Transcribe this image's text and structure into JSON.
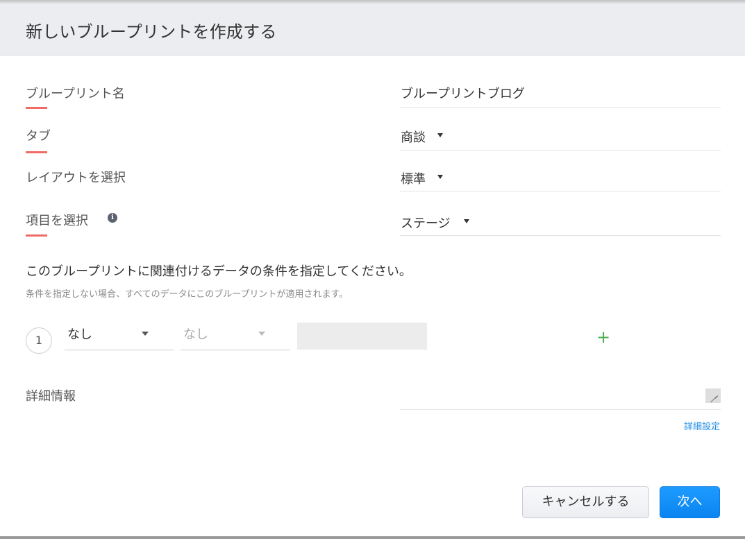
{
  "dialog": {
    "title": "新しいブループリントを作成する"
  },
  "fields": {
    "name": {
      "label": "ブループリント名",
      "value": "ブループリントブログ"
    },
    "tab": {
      "label": "タブ",
      "value": "商談"
    },
    "layout": {
      "label": "レイアウトを選択",
      "value": "標準"
    },
    "field": {
      "label": "項目を選択",
      "value": "ステージ",
      "info_icon": "info-icon"
    }
  },
  "criteria": {
    "title": "このブループリントに関連付けるデータの条件を指定してください。",
    "subtitle": "条件を指定しない場合、すべてのデータにこのブループリントが適用されます。",
    "row": {
      "index": "1",
      "field_select": "なし",
      "operator_select": "なし",
      "value": ""
    },
    "add_icon": "+"
  },
  "details": {
    "label": "詳細情報",
    "value": "",
    "advanced_link": "詳細設定"
  },
  "buttons": {
    "cancel": "キャンセルする",
    "next": "次へ"
  },
  "colors": {
    "accent": "#0a84f0",
    "required_marker": "#f06b63",
    "add_icon": "#4caf50",
    "link": "#1a8ae5"
  }
}
